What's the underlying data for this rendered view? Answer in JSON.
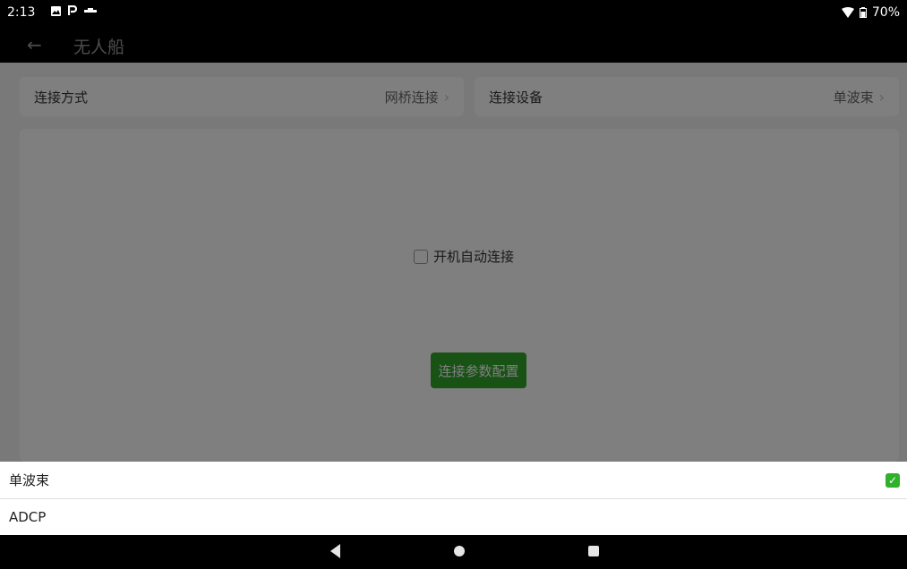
{
  "status_bar": {
    "time": "2:13",
    "icons_left": [
      "image-icon",
      "p-icon",
      "dash-icon"
    ],
    "wifi_icon": "wifi-icon",
    "battery_icon": "battery-icon",
    "battery_percent": "70%"
  },
  "app_bar": {
    "back_icon": "back-arrow-icon",
    "title": "无人船"
  },
  "settings": {
    "connection_method": {
      "label": "连接方式",
      "value": "网桥连接"
    },
    "connection_device": {
      "label": "连接设备",
      "value": "单波束"
    }
  },
  "panel": {
    "auto_connect_label": "开机自动连接",
    "auto_connect_checked": false,
    "config_button_label": "连接参数配置"
  },
  "sheet": {
    "options": [
      {
        "label": "单波束",
        "selected": true
      },
      {
        "label": "ADCP",
        "selected": false
      }
    ]
  },
  "colors": {
    "accent_green": "#30a52a",
    "check_green": "#2fb12a",
    "overlay": "rgba(0,0,0,0.5)"
  }
}
